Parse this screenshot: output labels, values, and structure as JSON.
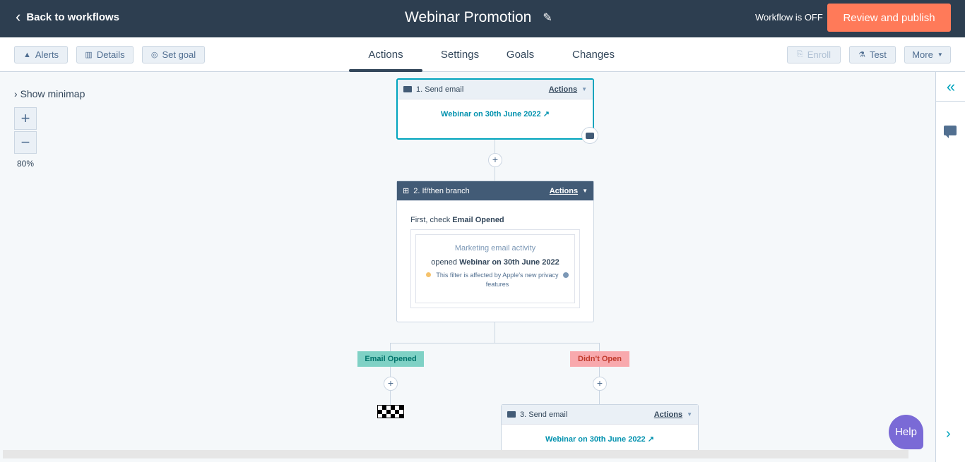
{
  "header": {
    "back_label": "Back to workflows",
    "workflow_title": "Webinar Promotion",
    "status": "Workflow is OFF",
    "publish_label": "Review and publish"
  },
  "toolbar": {
    "alerts_label": "Alerts",
    "details_label": "Details",
    "set_goal_label": "Set goal",
    "enroll_label": "Enroll",
    "test_label": "Test",
    "more_label": "More"
  },
  "tabs": [
    {
      "label": "Actions",
      "active": true
    },
    {
      "label": "Settings",
      "active": false
    },
    {
      "label": "Goals",
      "active": false
    },
    {
      "label": "Changes",
      "active": false
    }
  ],
  "canvas": {
    "minimap_label": "Show minimap",
    "zoom_in": "+",
    "zoom_out": "−",
    "zoom_level": "80%"
  },
  "steps": {
    "step1": {
      "title": "1. Send email",
      "actions_label": "Actions",
      "email_link": "Webinar on 30th June 2022"
    },
    "step2": {
      "title": "2. If/then branch",
      "actions_label": "Actions",
      "check_prefix": "First, check",
      "check_property": "Email Opened",
      "filter_category": "Marketing email activity",
      "filter_verb": "opened",
      "filter_value": "Webinar on 30th June 2022",
      "filter_note": "This filter is affected by Apple's new privacy features"
    },
    "branch_yes": "Email Opened",
    "branch_no": "Didn't Open",
    "step3": {
      "title": "3. Send email",
      "actions_label": "Actions",
      "email_link": "Webinar on 30th June 2022"
    }
  },
  "help_label": "Help",
  "colors": {
    "topbar": "#2d3e50",
    "accent": "#ff7a59",
    "teal": "#00a4bd",
    "branch_yes_bg": "#7fd1c5",
    "branch_no_bg": "#f8a9ad"
  }
}
